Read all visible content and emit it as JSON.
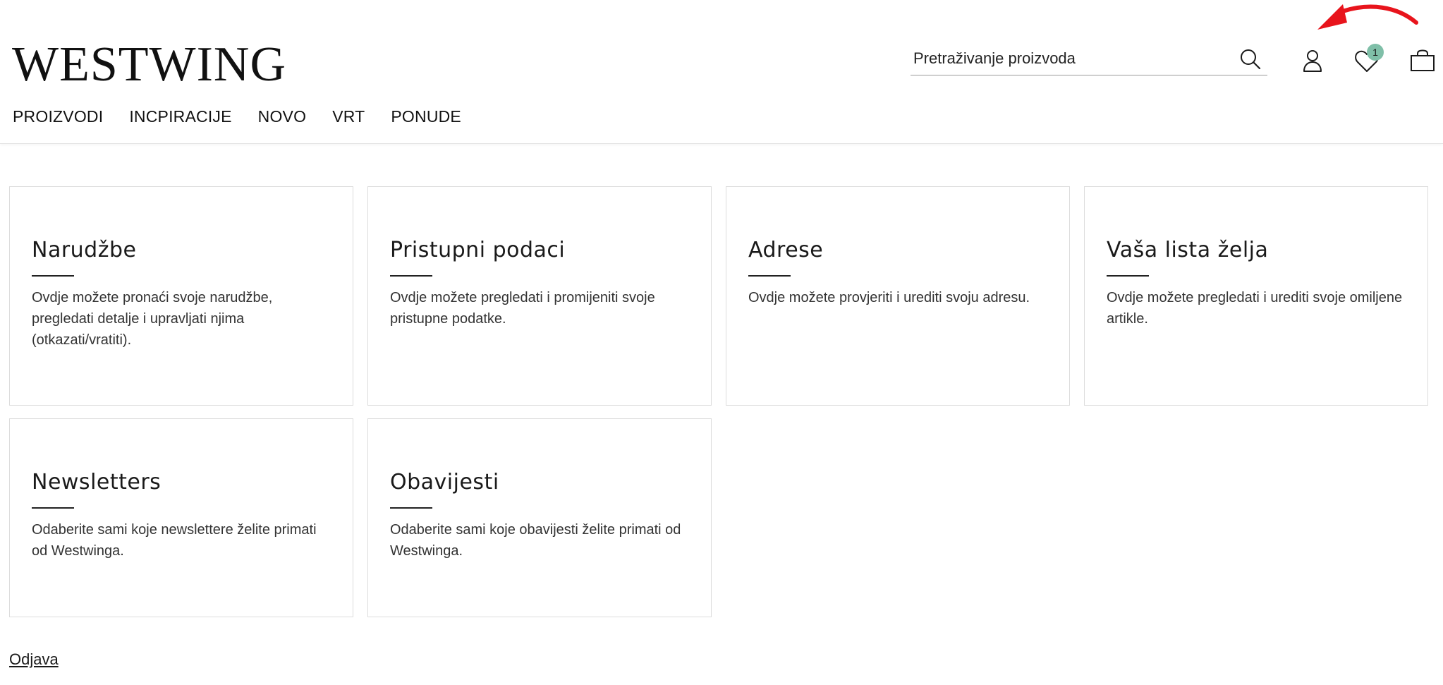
{
  "brand": {
    "logo_text": "WESTWING"
  },
  "search": {
    "placeholder": "Pretraživanje proizvoda",
    "value": "",
    "icon": "search-icon"
  },
  "header_icons": {
    "account_icon": "user-icon",
    "wishlist_icon": "heart-icon",
    "wishlist_count": "1",
    "cart_icon": "bag-icon",
    "badge_color": "#7fbfa8"
  },
  "nav": {
    "items": [
      {
        "label": "PROIZVODI"
      },
      {
        "label": "INCPIRACIJE"
      },
      {
        "label": "NOVO"
      },
      {
        "label": "VRT"
      },
      {
        "label": "PONUDE"
      }
    ]
  },
  "annotations": {
    "arrow_color": "#e8141c"
  },
  "cards": [
    {
      "title": "Narudžbe",
      "description": "Ovdje možete pronaći svoje narudžbe, pregledati detalje i upravljati njima (otkazati/vratiti)."
    },
    {
      "title": "Pristupni podaci",
      "description": "Ovdje možete pregledati i promijeniti svoje pristupne podatke."
    },
    {
      "title": "Adrese",
      "description": "Ovdje možete provjeriti i urediti svoju adresu."
    },
    {
      "title": "Vaša lista želja",
      "description": "Ovdje možete pregledati i urediti svoje omiljene artikle."
    },
    {
      "title": "Newsletters",
      "description": "Odaberite sami koje newslettere želite primati od Westwinga."
    },
    {
      "title": "Obavijesti",
      "description": "Odaberite sami koje obavijesti želite primati od Westwinga."
    }
  ],
  "footer": {
    "logout_label": "Odjava"
  }
}
